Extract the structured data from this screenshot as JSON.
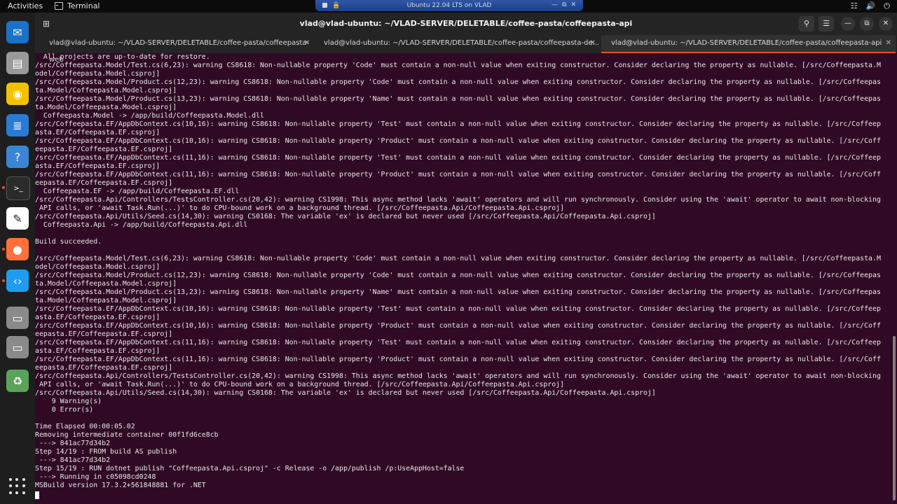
{
  "topbar": {
    "activities": "Activities",
    "app_name": "Terminal",
    "tray_icons": [
      "network-icon",
      "volume-icon",
      "power-icon"
    ]
  },
  "vm_bar": {
    "title": "Ubuntu 22.04 LTS on VLAD",
    "controls": [
      "minimize",
      "restore",
      "close"
    ]
  },
  "dock": {
    "items": [
      {
        "name": "thunderbird",
        "color": "#1b72c8"
      },
      {
        "name": "files",
        "color": "#9a9a9a"
      },
      {
        "name": "rhythmbox",
        "color": "#f2c200"
      },
      {
        "name": "libreoffice-writer",
        "color": "#2a7bd6"
      },
      {
        "name": "help",
        "color": "#3a86d4"
      },
      {
        "name": "terminal",
        "color": "#2b2b2b"
      },
      {
        "name": "inkscape",
        "color": "#ffffff"
      },
      {
        "name": "firefox",
        "color": "#ff7139"
      },
      {
        "name": "vscode",
        "color": "#1f9cf0"
      },
      {
        "name": "disk",
        "color": "#8a8a8a"
      },
      {
        "name": "disk-2",
        "color": "#8a8a8a"
      },
      {
        "name": "trash",
        "color": "#5aa35a"
      }
    ]
  },
  "window": {
    "title": "vlad@vlad-ubuntu: ~/VLAD-SERVER/DELETABLE/coffee-pasta/coffeepasta-api"
  },
  "tabs": [
    {
      "label": "vlad@vlad-ubuntu: ~/VLAD-SERVER/DELETABLE/coffee-pasta/coffeepasta-web",
      "active": false
    },
    {
      "label": "vlad@vlad-ubuntu: ~/VLAD-SERVER/DELETABLE/coffee-pasta/coffeepasta-de...",
      "active": false
    },
    {
      "label": "vlad@vlad-ubuntu: ~/VLAD-SERVER/DELETABLE/coffee-pasta/coffeepasta-api",
      "active": true
    }
  ],
  "output": [
    "  All projects are up-to-date for restore.",
    "/src/Coffeepasta.Model/Test.cs(6,23): warning CS8618: Non-nullable property 'Code' must contain a non-null value when exiting constructor. Consider declaring the property as nullable. [/src/Coffeepasta.M",
    "odel/Coffeepasta.Model.csproj]",
    "/src/Coffeepasta.Model/Product.cs(12,23): warning CS8618: Non-nullable property 'Code' must contain a non-null value when exiting constructor. Consider declaring the property as nullable. [/src/Coffeepas",
    "ta.Model/Coffeepasta.Model.csproj]",
    "/src/Coffeepasta.Model/Product.cs(13,23): warning CS8618: Non-nullable property 'Name' must contain a non-null value when exiting constructor. Consider declaring the property as nullable. [/src/Coffeepas",
    "ta.Model/Coffeepasta.Model.csproj]",
    "  Coffeepasta.Model -> /app/build/Coffeepasta.Model.dll",
    "/src/Coffeepasta.EF/AppDbContext.cs(10,16): warning CS8618: Non-nullable property 'Test' must contain a non-null value when exiting constructor. Consider declaring the property as nullable. [/src/Coffeep",
    "asta.EF/Coffeepasta.EF.csproj]",
    "/src/Coffeepasta.EF/AppDbContext.cs(10,16): warning CS8618: Non-nullable property 'Product' must contain a non-null value when exiting constructor. Consider declaring the property as nullable. [/src/Coff",
    "eepasta.EF/Coffeepasta.EF.csproj]",
    "/src/Coffeepasta.EF/AppDbContext.cs(11,16): warning CS8618: Non-nullable property 'Test' must contain a non-null value when exiting constructor. Consider declaring the property as nullable. [/src/Coffeep",
    "asta.EF/Coffeepasta.EF.csproj]",
    "/src/Coffeepasta.EF/AppDbContext.cs(11,16): warning CS8618: Non-nullable property 'Product' must contain a non-null value when exiting constructor. Consider declaring the property as nullable. [/src/Coff",
    "eepasta.EF/Coffeepasta.EF.csproj]",
    "  Coffeepasta.EF -> /app/build/Coffeepasta.EF.dll",
    "/src/Coffeepasta.Api/Controllers/TestsController.cs(20,42): warning CS1998: This async method lacks 'await' operators and will run synchronously. Consider using the 'await' operator to await non-blocking",
    " API calls, or 'await Task.Run(...)' to do CPU-bound work on a background thread. [/src/Coffeepasta.Api/Coffeepasta.Api.csproj]",
    "/src/Coffeepasta.Api/Utils/Seed.cs(14,30): warning CS0168: The variable 'ex' is declared but never used [/src/Coffeepasta.Api/Coffeepasta.Api.csproj]",
    "  Coffeepasta.Api -> /app/build/Coffeepasta.Api.dll",
    "",
    "Build succeeded.",
    "",
    "/src/Coffeepasta.Model/Test.cs(6,23): warning CS8618: Non-nullable property 'Code' must contain a non-null value when exiting constructor. Consider declaring the property as nullable. [/src/Coffeepasta.M",
    "odel/Coffeepasta.Model.csproj]",
    "/src/Coffeepasta.Model/Product.cs(12,23): warning CS8618: Non-nullable property 'Code' must contain a non-null value when exiting constructor. Consider declaring the property as nullable. [/src/Coffeepas",
    "ta.Model/Coffeepasta.Model.csproj]",
    "/src/Coffeepasta.Model/Product.cs(13,23): warning CS8618: Non-nullable property 'Name' must contain a non-null value when exiting constructor. Consider declaring the property as nullable. [/src/Coffeepas",
    "ta.Model/Coffeepasta.Model.csproj]",
    "/src/Coffeepasta.EF/AppDbContext.cs(10,16): warning CS8618: Non-nullable property 'Test' must contain a non-null value when exiting constructor. Consider declaring the property as nullable. [/src/Coffeep",
    "asta.EF/Coffeepasta.EF.csproj]",
    "/src/Coffeepasta.EF/AppDbContext.cs(10,16): warning CS8618: Non-nullable property 'Product' must contain a non-null value when exiting constructor. Consider declaring the property as nullable. [/src/Coff",
    "eepasta.EF/Coffeepasta.EF.csproj]",
    "/src/Coffeepasta.EF/AppDbContext.cs(11,16): warning CS8618: Non-nullable property 'Test' must contain a non-null value when exiting constructor. Consider declaring the property as nullable. [/src/Coffeep",
    "asta.EF/Coffeepasta.EF.csproj]",
    "/src/Coffeepasta.EF/AppDbContext.cs(11,16): warning CS8618: Non-nullable property 'Product' must contain a non-null value when exiting constructor. Consider declaring the property as nullable. [/src/Coff",
    "eepasta.EF/Coffeepasta.EF.csproj]",
    "/src/Coffeepasta.Api/Controllers/TestsController.cs(20,42): warning CS1998: This async method lacks 'await' operators and will run synchronously. Consider using the 'await' operator to await non-blocking",
    " API calls, or 'await Task.Run(...)' to do CPU-bound work on a background thread. [/src/Coffeepasta.Api/Coffeepasta.Api.csproj]",
    "/src/Coffeepasta.Api/Utils/Seed.cs(14,30): warning CS0168: The variable 'ex' is declared but never used [/src/Coffeepasta.Api/Coffeepasta.Api.csproj]",
    "    9 Warning(s)",
    "    0 Error(s)",
    "",
    "Time Elapsed 00:00:05.02",
    "Removing intermediate container 00f1fd6ce8cb",
    " ---> 841ac77d34b2",
    "Step 14/19 : FROM build AS publish",
    " ---> 841ac77d34b2",
    "Step 15/19 : RUN dotnet publish \"Coffeepasta.Api.csproj\" -c Release -o /app/publish /p:UseAppHost=false",
    " ---> Running in c05098cd0248",
    "MSBuild version 17.3.2+561848881 for .NET"
  ]
}
